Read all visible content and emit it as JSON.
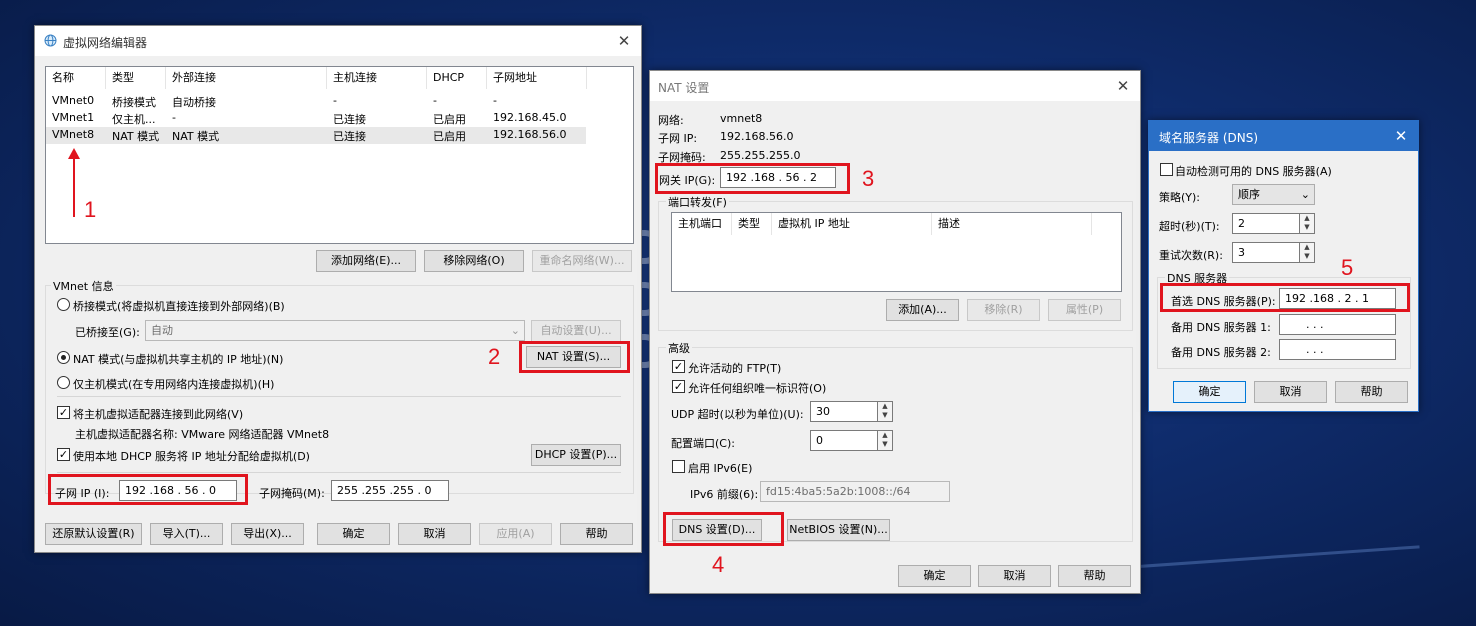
{
  "w1": {
    "title": "虚拟网络编辑器",
    "columns": [
      "名称",
      "类型",
      "外部连接",
      "主机连接",
      "DHCP",
      "子网地址"
    ],
    "rows": [
      [
        "VMnet0",
        "桥接模式",
        "自动桥接",
        "-",
        "-",
        "-"
      ],
      [
        "VMnet1",
        "仅主机...",
        "-",
        "已连接",
        "已启用",
        "192.168.45.0"
      ],
      [
        "VMnet8",
        "NAT 模式",
        "NAT 模式",
        "已连接",
        "已启用",
        "192.168.56.0"
      ]
    ],
    "add_network": "添加网络(E)...",
    "remove_network": "移除网络(O)",
    "rename_network": "重命名网络(W)...",
    "vmnet_info": "VMnet 信息",
    "bridge_mode": "桥接模式(将虚拟机直接连接到外部网络)(B)",
    "bridged_to_label": "已桥接至(G):",
    "bridged_to_value": "自动",
    "auto_settings": "自动设置(U)...",
    "nat_mode": "NAT 模式(与虚拟机共享主机的 IP 地址)(N)",
    "nat_settings": "NAT 设置(S)...",
    "host_only": "仅主机模式(在专用网络内连接虚拟机)(H)",
    "connect_adapter": "将主机虚拟适配器连接到此网络(V)",
    "adapter_name": "主机虚拟适配器名称: VMware 网络适配器 VMnet8",
    "use_dhcp": "使用本地 DHCP 服务将 IP 地址分配给虚拟机(D)",
    "dhcp_settings": "DHCP 设置(P)...",
    "subnet_ip_label": "子网 IP (I):",
    "subnet_ip": "192 .168 . 56  .  0",
    "subnet_mask_label": "子网掩码(M):",
    "subnet_mask": "255 .255 .255 .  0",
    "restore_defaults": "还原默认设置(R)",
    "import": "导入(T)...",
    "export": "导出(X)...",
    "ok": "确定",
    "cancel": "取消",
    "apply": "应用(A)",
    "help": "帮助"
  },
  "w2": {
    "title": "NAT 设置",
    "network_label": "网络:",
    "network": "vmnet8",
    "subnet_ip_label": "子网 IP:",
    "subnet_ip": "192.168.56.0",
    "subnet_mask_label": "子网掩码:",
    "subnet_mask": "255.255.255.0",
    "gateway_label": "网关 IP(G):",
    "gateway": "192 .168 . 56  .  2",
    "port_forward": "端口转发(F)",
    "pf_columns": [
      "主机端口",
      "类型",
      "虚拟机 IP 地址",
      "描述"
    ],
    "add": "添加(A)...",
    "remove": "移除(R)",
    "properties": "属性(P)",
    "advanced": "高级",
    "allow_ftp": "允许活动的 FTP(T)",
    "allow_oui": "允许任何组织唯一标识符(O)",
    "udp_timeout_label": "UDP 超时(以秒为单位)(U):",
    "udp_timeout": "30",
    "config_port_label": "配置端口(C):",
    "config_port": "0",
    "enable_ipv6": "启用 IPv6(E)",
    "ipv6_prefix_label": "IPv6 前缀(6):",
    "ipv6_prefix": "fd15:4ba5:5a2b:1008::/64",
    "dns_settings": "DNS 设置(D)...",
    "netbios_settings": "NetBIOS 设置(N)...",
    "ok": "确定",
    "cancel": "取消",
    "help": "帮助"
  },
  "w3": {
    "title": "域名服务器 (DNS)",
    "auto_detect": "自动检测可用的 DNS 服务器(A)",
    "policy_label": "策略(Y):",
    "policy": "顺序",
    "timeout_label": "超时(秒)(T):",
    "timeout": "2",
    "retries_label": "重试次数(R):",
    "retries": "3",
    "dns_group": "DNS 服务器",
    "preferred_label": "首选 DNS 服务器(P):",
    "preferred": "192 .168 .  2  .  1",
    "alt1_label": "备用 DNS 服务器 1:",
    "alt1": ".        .        .",
    "alt2_label": "备用 DNS 服务器 2:",
    "alt2": ".        .        .",
    "ok": "确定",
    "cancel": "取消",
    "help": "帮助"
  },
  "annotations": [
    "1",
    "2",
    "3",
    "4",
    "5"
  ],
  "colors": {
    "annotation_red": "#e0141e",
    "dns_title_blue": "#2a6fc6",
    "desktop_blue": "#0f2c6c"
  }
}
